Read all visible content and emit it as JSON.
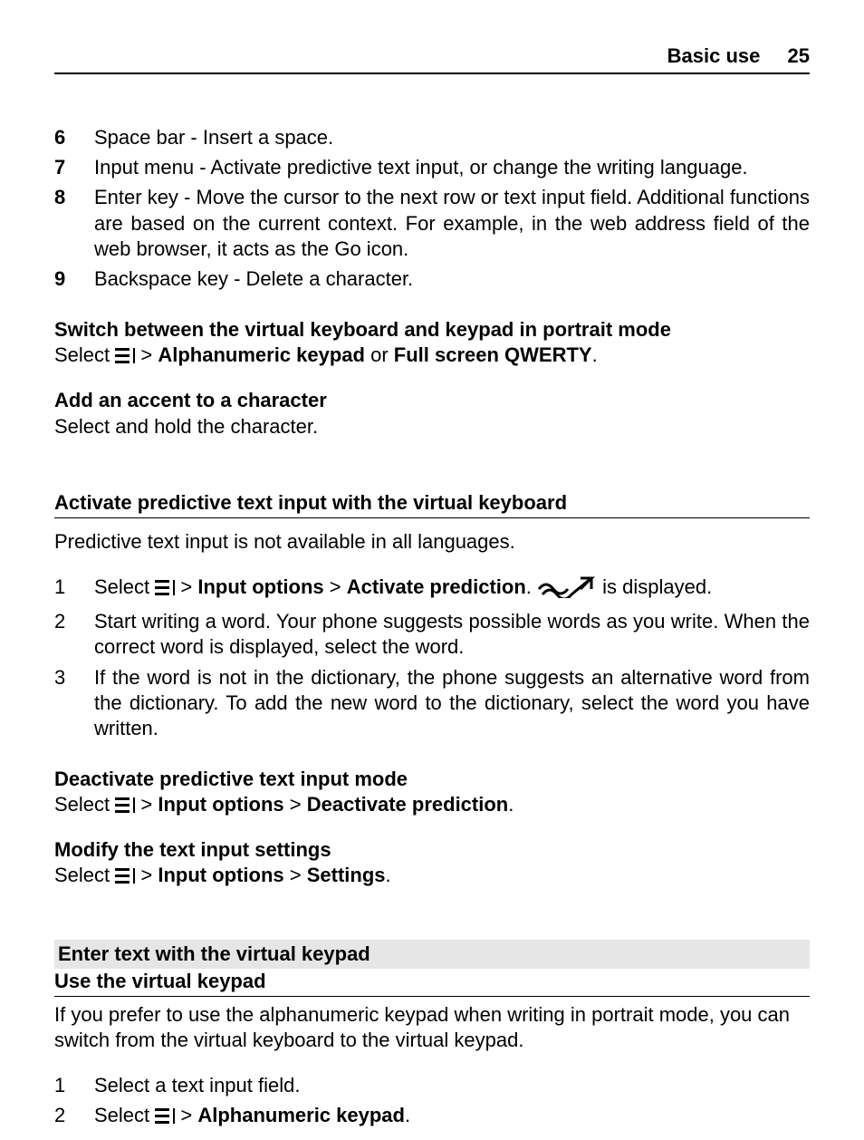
{
  "header": {
    "section": "Basic use",
    "page": "25"
  },
  "list1": [
    {
      "n": "6",
      "t": "Space bar - Insert a space."
    },
    {
      "n": "7",
      "t": "Input menu - Activate predictive text input, or change the writing language."
    },
    {
      "n": "8",
      "t": "Enter key - Move the cursor to the next row or text input field. Additional functions are based on the current context. For example, in the web address field of the web browser, it acts as the Go icon."
    },
    {
      "n": "9",
      "t": "Backspace key - Delete a character."
    }
  ],
  "sub1": {
    "head": "Switch between the virtual keyboard and keypad in portrait mode",
    "pre": "Select ",
    "gt": " > ",
    "opt1": "Alphanumeric keypad",
    "or": " or ",
    "opt2": "Full screen QWERTY",
    "dot": "."
  },
  "sub2": {
    "head": "Add an accent to a character",
    "body": "Select and hold the character."
  },
  "sec1": {
    "title": "Activate predictive text input with the virtual keyboard",
    "intro": "Predictive text input is not available in all languages.",
    "steps": {
      "s1": {
        "n": "1",
        "pre": "Select ",
        "gt1": " > ",
        "b1": "Input options ",
        "gt2": " > ",
        "b2": "Activate prediction",
        "dot": ". ",
        "post": " is displayed."
      },
      "s2": {
        "n": "2",
        "t": "Start writing a word. Your phone suggests possible words as you write. When the correct word is displayed, select the word."
      },
      "s3": {
        "n": "3",
        "t": "If the word is not in the dictionary, the phone suggests an alternative word from the dictionary. To add the new word to the dictionary, select the word you have written."
      }
    }
  },
  "sub3": {
    "head": "Deactivate predictive text input mode",
    "pre": "Select ",
    "gt1": " > ",
    "b1": "Input options ",
    "gt2": " > ",
    "b2": "Deactivate prediction",
    "dot": "."
  },
  "sub4": {
    "head": "Modify the text input settings",
    "pre": "Select ",
    "gt1": " > ",
    "b1": "Input options ",
    "gt2": " > ",
    "b2": "Settings",
    "dot": "."
  },
  "sec2": {
    "gray": "Enter text with the virtual keypad",
    "head": "Use the virtual keypad",
    "intro": "If you prefer to use the alphanumeric keypad when writing in portrait mode, you can switch from the virtual keyboard to the virtual keypad.",
    "steps": {
      "s1": {
        "n": "1",
        "t": "Select a text input field."
      },
      "s2": {
        "n": "2",
        "pre": "Select ",
        "gt": " > ",
        "b1": "Alphanumeric keypad",
        "dot": "."
      }
    }
  }
}
